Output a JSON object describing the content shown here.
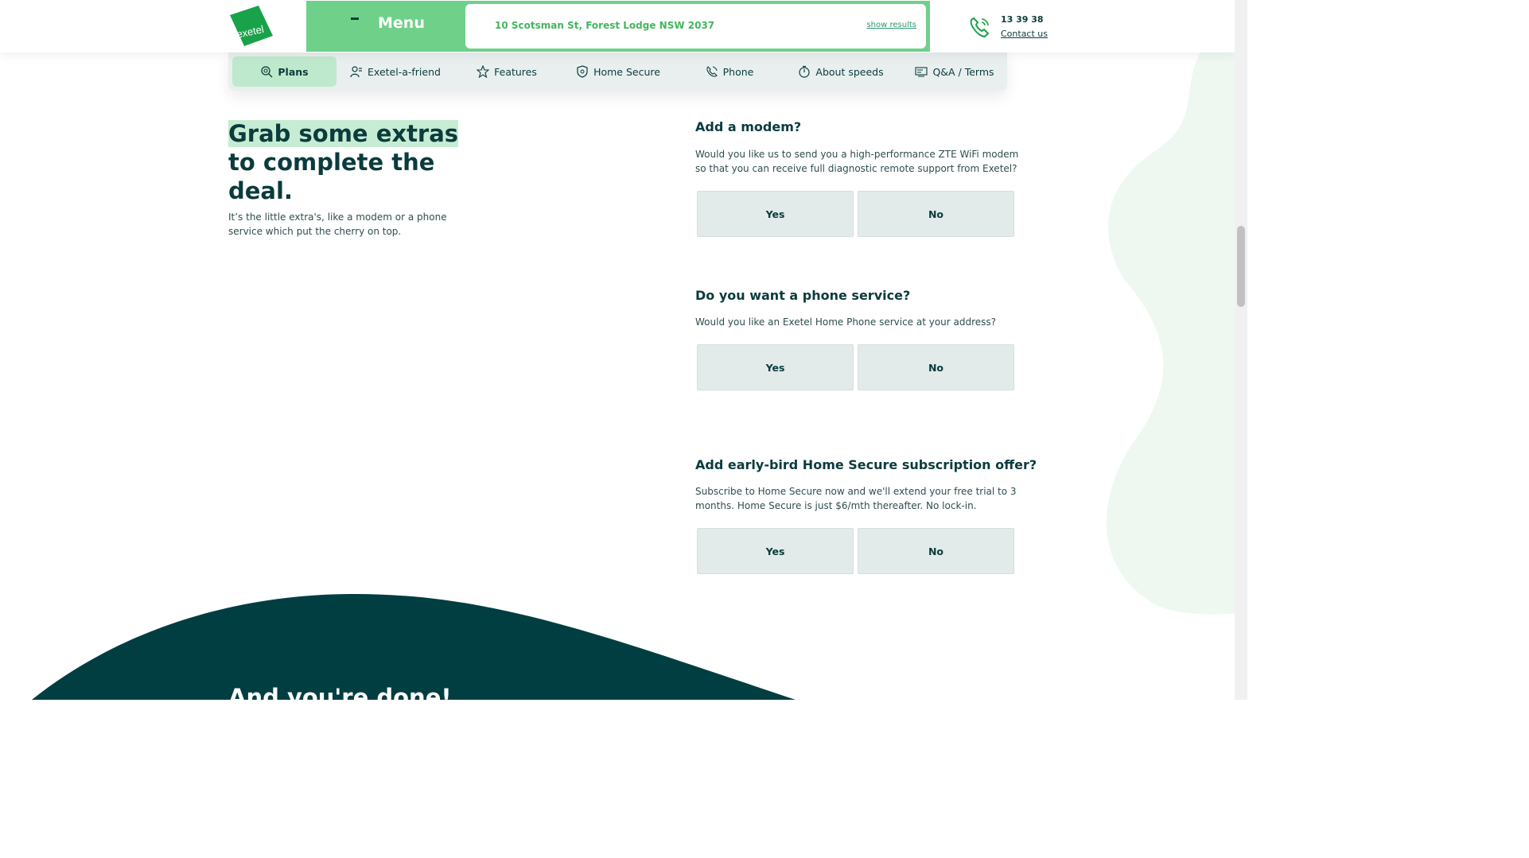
{
  "header": {
    "logo_text": "exetel",
    "menu_label": "Menu",
    "address": "10 Scotsman St, Forest Lodge NSW 2037",
    "show_results": "show results",
    "phone_number": "13 39 38",
    "contact_us": "Contact us"
  },
  "subnav": {
    "items": [
      {
        "label": "Plans",
        "icon": "search-plan-icon"
      },
      {
        "label": "Exetel-a-friend",
        "icon": "friend-icon"
      },
      {
        "label": "Features",
        "icon": "star-icon"
      },
      {
        "label": "Home Secure",
        "icon": "shield-icon"
      },
      {
        "label": "Phone",
        "icon": "phone-icon"
      },
      {
        "label": "About speeds",
        "icon": "stopwatch-icon"
      },
      {
        "label": "Q&A / Terms",
        "icon": "document-icon"
      }
    ]
  },
  "hero": {
    "title_highlight": "Grab some extras",
    "title_rest_1": "to complete the",
    "title_rest_2": "deal.",
    "subtitle": "It’s the little extra's, like a modem or a phone service which put the cherry on top."
  },
  "questions": [
    {
      "title": "Add a modem?",
      "description": "Would you like us to send you a high-performance ZTE WiFi modem so that you can receive full diagnostic remote support from Exetel?",
      "yes": "Yes",
      "no": "No"
    },
    {
      "title": "Do you want a phone service?",
      "description": "Would you like an Exetel Home Phone service at your address?",
      "yes": "Yes",
      "no": "No"
    },
    {
      "title": "Add early-bird Home Secure subscription offer?",
      "description": "Subscribe to Home Secure now and we'll extend your free trial to 3 months. Home Secure is just $6/mth thereafter. No lock-in.",
      "yes": "Yes",
      "no": "No"
    }
  ],
  "footer_section": {
    "title": "And you're done!"
  },
  "colors": {
    "brand_green": "#43b65e",
    "menu_green": "#6fd08a",
    "dark_teal": "#003e42",
    "option_bg": "#e3eaea",
    "active_nav": "#bfe9cc"
  }
}
